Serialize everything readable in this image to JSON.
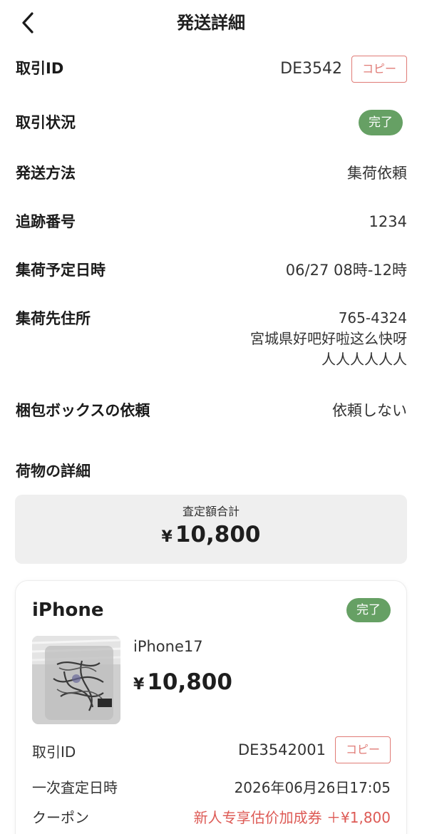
{
  "header": {
    "title": "発送詳細"
  },
  "rows": {
    "transaction_id": {
      "label": "取引ID",
      "value": "DE3542",
      "copy": "コピー"
    },
    "status": {
      "label": "取引状況",
      "value": "完了"
    },
    "shipping_method": {
      "label": "発送方法",
      "value": "集荷依頼"
    },
    "tracking_number": {
      "label": "追跡番号",
      "value": "1234"
    },
    "pickup_date": {
      "label": "集荷予定日時",
      "value": "06/27 08時-12時"
    },
    "pickup_address": {
      "label": "集荷先住所",
      "postal": "765-4324",
      "line1": "宮城県好吧好啦这么快呀",
      "line2": "人人人人人人"
    },
    "packing_box": {
      "label": "梱包ボックスの依頼",
      "value": "依頼しない"
    }
  },
  "package_section": {
    "title": "荷物の詳細"
  },
  "total": {
    "label": "査定額合計",
    "currency": "¥",
    "amount": "10,800"
  },
  "item": {
    "title": "iPhone",
    "status": "完了",
    "name": "iPhone17",
    "currency": "¥",
    "price": "10,800",
    "transaction_id_label": "取引ID",
    "transaction_id": "DE3542001",
    "copy": "コピー",
    "assessment_label": "一次査定日時",
    "assessment_date": "2026年06月26日17:05",
    "coupon_label": "クーポン",
    "coupon_value": "新人专享估价加成券 ＋¥1,800"
  },
  "colors": {
    "accent_red": "#e07b76",
    "status_green": "#66a064",
    "coupon_red": "#dd5a55",
    "panel_gray": "#efefef"
  },
  "icons": {
    "back": "chevron-left-icon"
  }
}
